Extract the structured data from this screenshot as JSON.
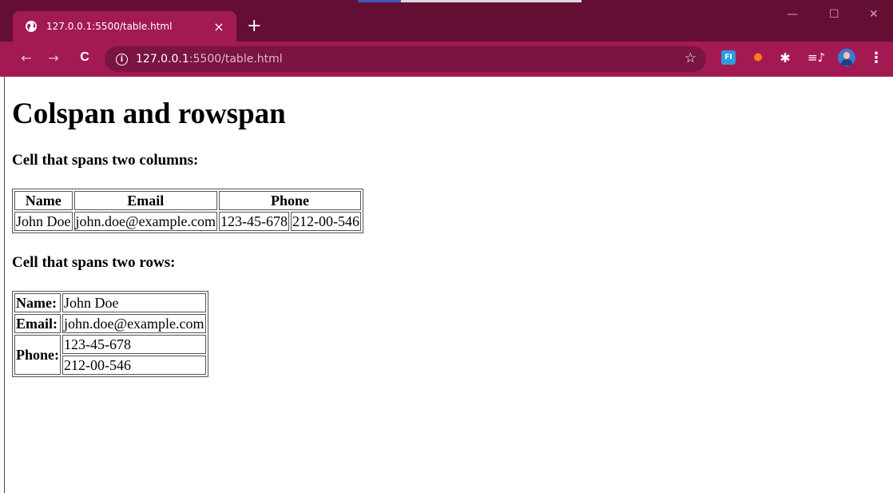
{
  "browser": {
    "tab_title": "127.0.0.1:5500/table.html",
    "tab_close": "×",
    "new_tab": "+",
    "url_host": "127.0.0.1",
    "url_path": ":5500/table.html",
    "back": "←",
    "forward": "→",
    "reload": "C",
    "info": "i",
    "star": "☆",
    "ext_fi": "FI",
    "ext_fire": "●",
    "ext_puzzle": "✱",
    "ext_media": "≡♪",
    "menu": "⋮",
    "win_min": "—",
    "win_max": "☐",
    "win_close": "✕",
    "colors": {
      "tabstrip": "#650e33",
      "toolbar": "#a31a52",
      "omnibox": "#7a1440"
    }
  },
  "page": {
    "heading": "Colspan and rowspan",
    "section1_title": "Cell that spans two columns:",
    "table1": {
      "headers": [
        "Name",
        "Email",
        "Phone"
      ],
      "row": [
        "John Doe",
        "john.doe@example.com",
        "123-45-678",
        "212-00-546"
      ]
    },
    "section2_title": "Cell that spans two rows:",
    "table2": {
      "name_label": "Name:",
      "name_value": "John Doe",
      "email_label": "Email:",
      "email_value": "john.doe@example.com",
      "phone_label": "Phone:",
      "phone_values": [
        "123-45-678",
        "212-00-546"
      ]
    }
  }
}
